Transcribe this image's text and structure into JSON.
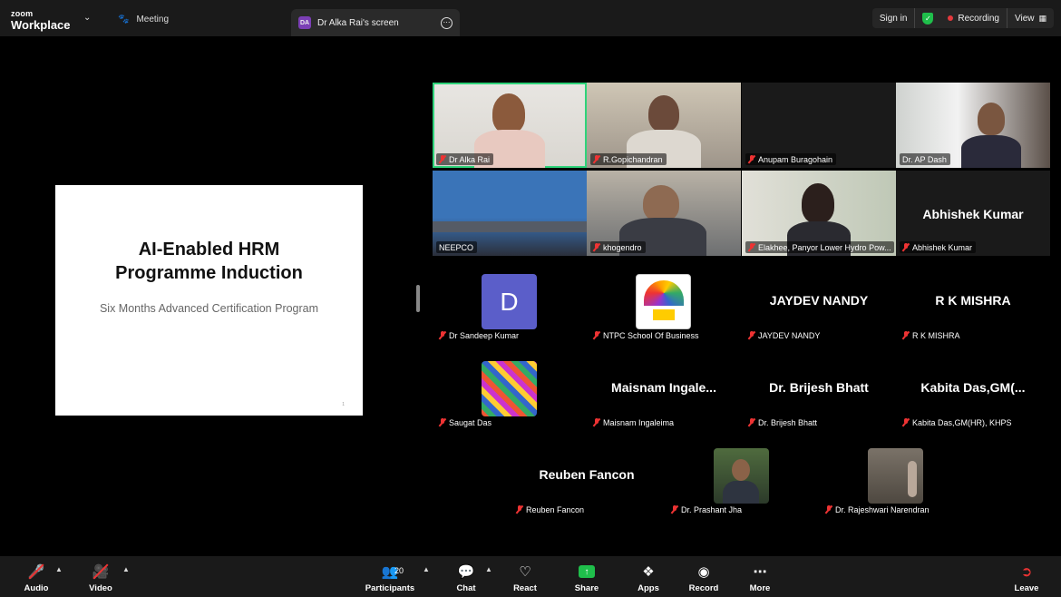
{
  "topbar": {
    "logo_line1": "zoom",
    "logo_line2": "Workplace",
    "meeting_tab": "Meeting",
    "screen_tab_badge": "DA",
    "screen_tab": "Dr Alka Rai's screen",
    "sign_in": "Sign in",
    "recording": "Recording",
    "view": "View"
  },
  "slide": {
    "title": "AI-Enabled HRM\nProgramme Induction",
    "subtitle": "Six Months Advanced Certification Program",
    "page_number": "1"
  },
  "participants": [
    {
      "name": "Dr Alka Rai",
      "kind": "video",
      "active_speaker": true
    },
    {
      "name": "R.Gopichandran",
      "kind": "video"
    },
    {
      "name": "Anupam Buragohain",
      "kind": "blank"
    },
    {
      "name": "Dr. AP Dash",
      "kind": "video"
    },
    {
      "name": "NEEPCO",
      "kind": "video"
    },
    {
      "name": "khogendro",
      "kind": "video"
    },
    {
      "name": "Elakhee, Panyor Lower Hydro Pow...",
      "kind": "video"
    },
    {
      "name": "Abhishek Kumar",
      "kind": "name",
      "display": "Abhishek Kumar"
    },
    {
      "name": "Dr Sandeep Kumar",
      "kind": "avatar",
      "avatar_letter": "D"
    },
    {
      "name": "NTPC School Of Business",
      "kind": "avatar"
    },
    {
      "name": "JAYDEV NANDY",
      "kind": "name",
      "display": "JAYDEV NANDY"
    },
    {
      "name": "R K MISHRA",
      "kind": "name",
      "display": "R K MISHRA"
    },
    {
      "name": "Saugat Das",
      "kind": "avatar"
    },
    {
      "name": "Maisnam Ingaleima",
      "kind": "name",
      "display": "Maisnam  Ingale..."
    },
    {
      "name": "Dr. Brijesh Bhatt",
      "kind": "name",
      "display": "Dr. Brijesh Bhatt"
    },
    {
      "name": "Kabita Das,GM(HR), KHPS",
      "kind": "name",
      "display": "Kabita  Das,GM(..."
    },
    {
      "name": "Reuben Fancon",
      "kind": "name",
      "display": "Reuben Fancon"
    },
    {
      "name": "Dr. Prashant Jha",
      "kind": "avatar"
    },
    {
      "name": "Dr. Rajeshwari Narendran",
      "kind": "avatar"
    }
  ],
  "toolbar": {
    "audio": "Audio",
    "video": "Video",
    "participants": "Participants",
    "participant_count": "20",
    "chat": "Chat",
    "react": "React",
    "share": "Share",
    "apps": "Apps",
    "record": "Record",
    "more": "More",
    "leave": "Leave"
  },
  "colors": {
    "active_speaker_border": "#2fd37a",
    "share_green": "#1fbf4b",
    "recording_red": "#e5393d",
    "avatar_blue": "#5b5ec9"
  }
}
